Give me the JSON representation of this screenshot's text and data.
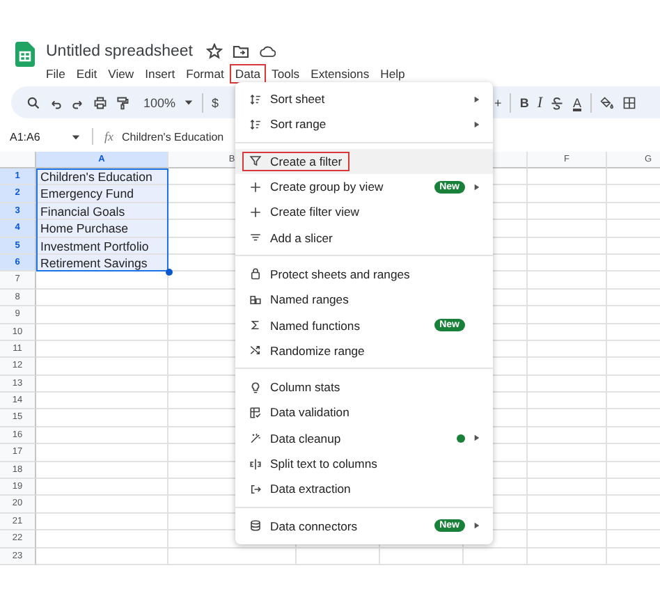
{
  "document": {
    "title": "Untitled spreadsheet"
  },
  "menu_bar": [
    {
      "label": "File",
      "selected": false
    },
    {
      "label": "Edit",
      "selected": false
    },
    {
      "label": "View",
      "selected": false
    },
    {
      "label": "Insert",
      "selected": false
    },
    {
      "label": "Format",
      "selected": false
    },
    {
      "label": "Data",
      "selected": true
    },
    {
      "label": "Tools",
      "selected": false
    },
    {
      "label": "Extensions",
      "selected": false
    },
    {
      "label": "Help",
      "selected": false
    }
  ],
  "toolbar": {
    "zoom": "100%",
    "currency": "$",
    "increase": "+",
    "bold": "B",
    "italic": "I",
    "text_color": "A"
  },
  "formula_bar": {
    "name_box": "A1:A6",
    "function_label": "fx",
    "value": "Children's Education"
  },
  "columns": [
    {
      "label": "A",
      "selected": true
    },
    {
      "label": "B",
      "selected": false
    },
    {
      "label": "F",
      "selected": false
    },
    {
      "label": "G",
      "selected": false
    }
  ],
  "rows": [
    {
      "label": "1",
      "cell_a": "Children's Education",
      "selected": true
    },
    {
      "label": "2",
      "cell_a": "Emergency Fund",
      "selected": true
    },
    {
      "label": "3",
      "cell_a": "Financial Goals",
      "selected": true
    },
    {
      "label": "4",
      "cell_a": "Home Purchase",
      "selected": true
    },
    {
      "label": "5",
      "cell_a": "Investment Portfolio",
      "selected": true
    },
    {
      "label": "6",
      "cell_a": "Retirement Savings",
      "selected": true
    },
    {
      "label": "7",
      "selected": false
    },
    {
      "label": "8",
      "selected": false
    },
    {
      "label": "9",
      "selected": false
    },
    {
      "label": "10",
      "selected": false
    },
    {
      "label": "11",
      "selected": false
    },
    {
      "label": "12",
      "selected": false
    },
    {
      "label": "13",
      "selected": false
    },
    {
      "label": "14",
      "selected": false
    },
    {
      "label": "15",
      "selected": false
    },
    {
      "label": "16",
      "selected": false
    },
    {
      "label": "17",
      "selected": false
    },
    {
      "label": "18",
      "selected": false
    },
    {
      "label": "19",
      "selected": false
    },
    {
      "label": "20",
      "selected": false
    },
    {
      "label": "21",
      "selected": false
    },
    {
      "label": "22",
      "selected": false
    },
    {
      "label": "23",
      "selected": false
    }
  ],
  "data_menu": {
    "groups": [
      [
        {
          "label": "Sort sheet",
          "selected": false,
          "submenu": true
        },
        {
          "label": "Sort range",
          "selected": false,
          "submenu": true
        }
      ],
      [
        {
          "label": "Create a filter",
          "selected": true,
          "submenu": false
        },
        {
          "label": "Create group by view",
          "selected": false,
          "submenu": true,
          "badge": "New"
        },
        {
          "label": "Create filter view",
          "selected": false,
          "submenu": false
        },
        {
          "label": "Add a slicer",
          "selected": false,
          "submenu": false
        }
      ],
      [
        {
          "label": "Protect sheets and ranges",
          "selected": false,
          "submenu": false
        },
        {
          "label": "Named ranges",
          "selected": false,
          "submenu": false
        },
        {
          "label": "Named functions",
          "selected": false,
          "submenu": false,
          "badge": "New"
        },
        {
          "label": "Randomize range",
          "selected": false,
          "submenu": false
        }
      ],
      [
        {
          "label": "Column stats",
          "selected": false,
          "submenu": false
        },
        {
          "label": "Data validation",
          "selected": false,
          "submenu": false
        },
        {
          "label": "Data cleanup",
          "selected": false,
          "submenu": true,
          "dot": true
        },
        {
          "label": "Split text to columns",
          "selected": false,
          "submenu": false
        },
        {
          "label": "Data extraction",
          "selected": false,
          "submenu": false
        }
      ],
      [
        {
          "label": "Data connectors",
          "selected": false,
          "submenu": true,
          "badge": "New"
        }
      ]
    ]
  }
}
